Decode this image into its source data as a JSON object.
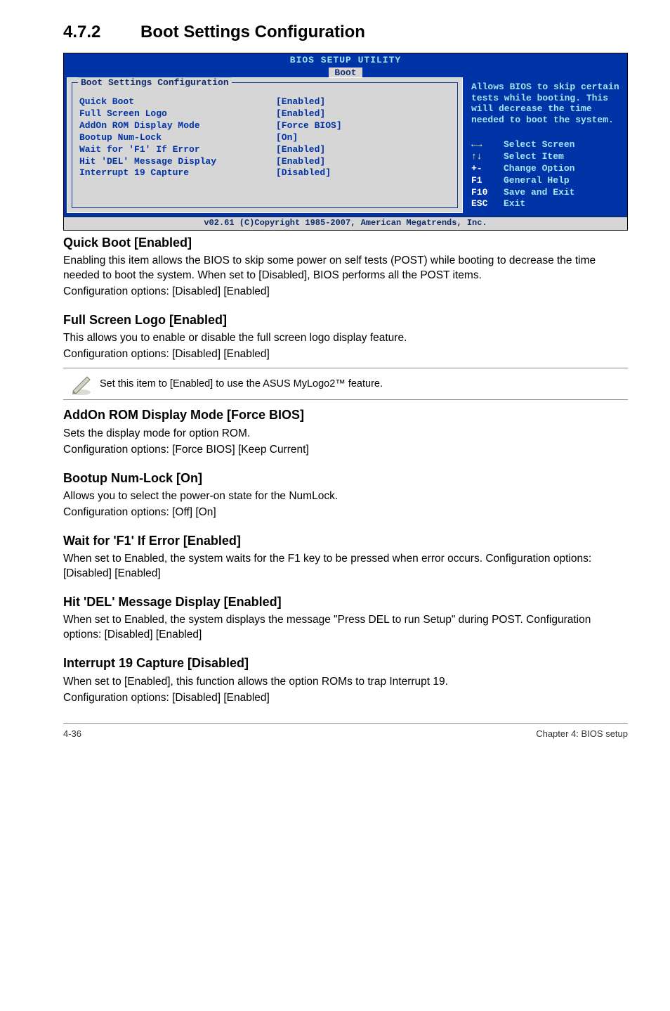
{
  "section": {
    "number": "4.7.2",
    "title": "Boot Settings Configuration"
  },
  "bios": {
    "header_title": "BIOS SETUP UTILITY",
    "tab": "Boot",
    "panel_label": "Boot Settings Configuration",
    "rows": [
      {
        "label": "Quick Boot",
        "value": "[Enabled]"
      },
      {
        "label": "Full Screen Logo",
        "value": "[Enabled]"
      },
      {
        "label": "AddOn ROM Display Mode",
        "value": "[Force BIOS]"
      },
      {
        "label": "Bootup Num-Lock",
        "value": "[On]"
      },
      {
        "label": "Wait for 'F1' If Error",
        "value": "[Enabled]"
      },
      {
        "label": "Hit 'DEL' Message Display",
        "value": "[Enabled]"
      },
      {
        "label": "Interrupt 19 Capture",
        "value": "[Disabled]"
      }
    ],
    "help": "Allows BIOS to skip certain tests while booting. This will decrease the time needed to boot the system.",
    "nav": [
      {
        "key": "←→",
        "text": "Select Screen"
      },
      {
        "key": "↑↓",
        "text": "Select Item"
      },
      {
        "key": "+-",
        "text": "Change Option"
      },
      {
        "key": "F1",
        "text": "General Help"
      },
      {
        "key": "F10",
        "text": "Save and Exit"
      },
      {
        "key": "ESC",
        "text": "Exit"
      }
    ],
    "footer": "v02.61 (C)Copyright 1985-2007, American Megatrends, Inc."
  },
  "content": {
    "quickboot": {
      "h": "Quick Boot [Enabled]",
      "p1": "Enabling this item allows the BIOS to skip some power on self tests (POST) while booting to decrease the time needed to boot the system. When set to [Disabled], BIOS performs all the POST items.",
      "p2": "Configuration options: [Disabled] [Enabled]"
    },
    "fullscreen": {
      "h": "Full Screen Logo [Enabled]",
      "p1": "This allows you to enable or disable the full screen logo display feature.",
      "p2": "Configuration options: [Disabled] [Enabled]"
    },
    "note": "Set this item to [Enabled] to use the ASUS MyLogo2™ feature.",
    "addon": {
      "h": "AddOn ROM Display Mode [Force BIOS]",
      "p1": "Sets the display mode for option ROM.",
      "p2": "Configuration options: [Force BIOS] [Keep Current]"
    },
    "numlock": {
      "h": "Bootup Num-Lock [On]",
      "p1": "Allows you to select the power-on state for the NumLock.",
      "p2": "Configuration options: [Off] [On]"
    },
    "waitf1": {
      "h": "Wait for 'F1' If Error [Enabled]",
      "p1": "When set to Enabled, the system waits for the F1 key to be pressed when error occurs. Configuration options: [Disabled] [Enabled]"
    },
    "hitdel": {
      "h": "Hit 'DEL' Message Display [Enabled]",
      "p1": "When set to Enabled, the system displays the message \"Press DEL to run Setup\" during POST. Configuration options: [Disabled] [Enabled]"
    },
    "int19": {
      "h": "Interrupt 19 Capture [Disabled]",
      "p1": "When set to [Enabled], this function allows the option ROMs to trap Interrupt 19.",
      "p2": "Configuration options: [Disabled] [Enabled]"
    }
  },
  "footer": {
    "left": "4-36",
    "right": "Chapter 4: BIOS setup"
  }
}
